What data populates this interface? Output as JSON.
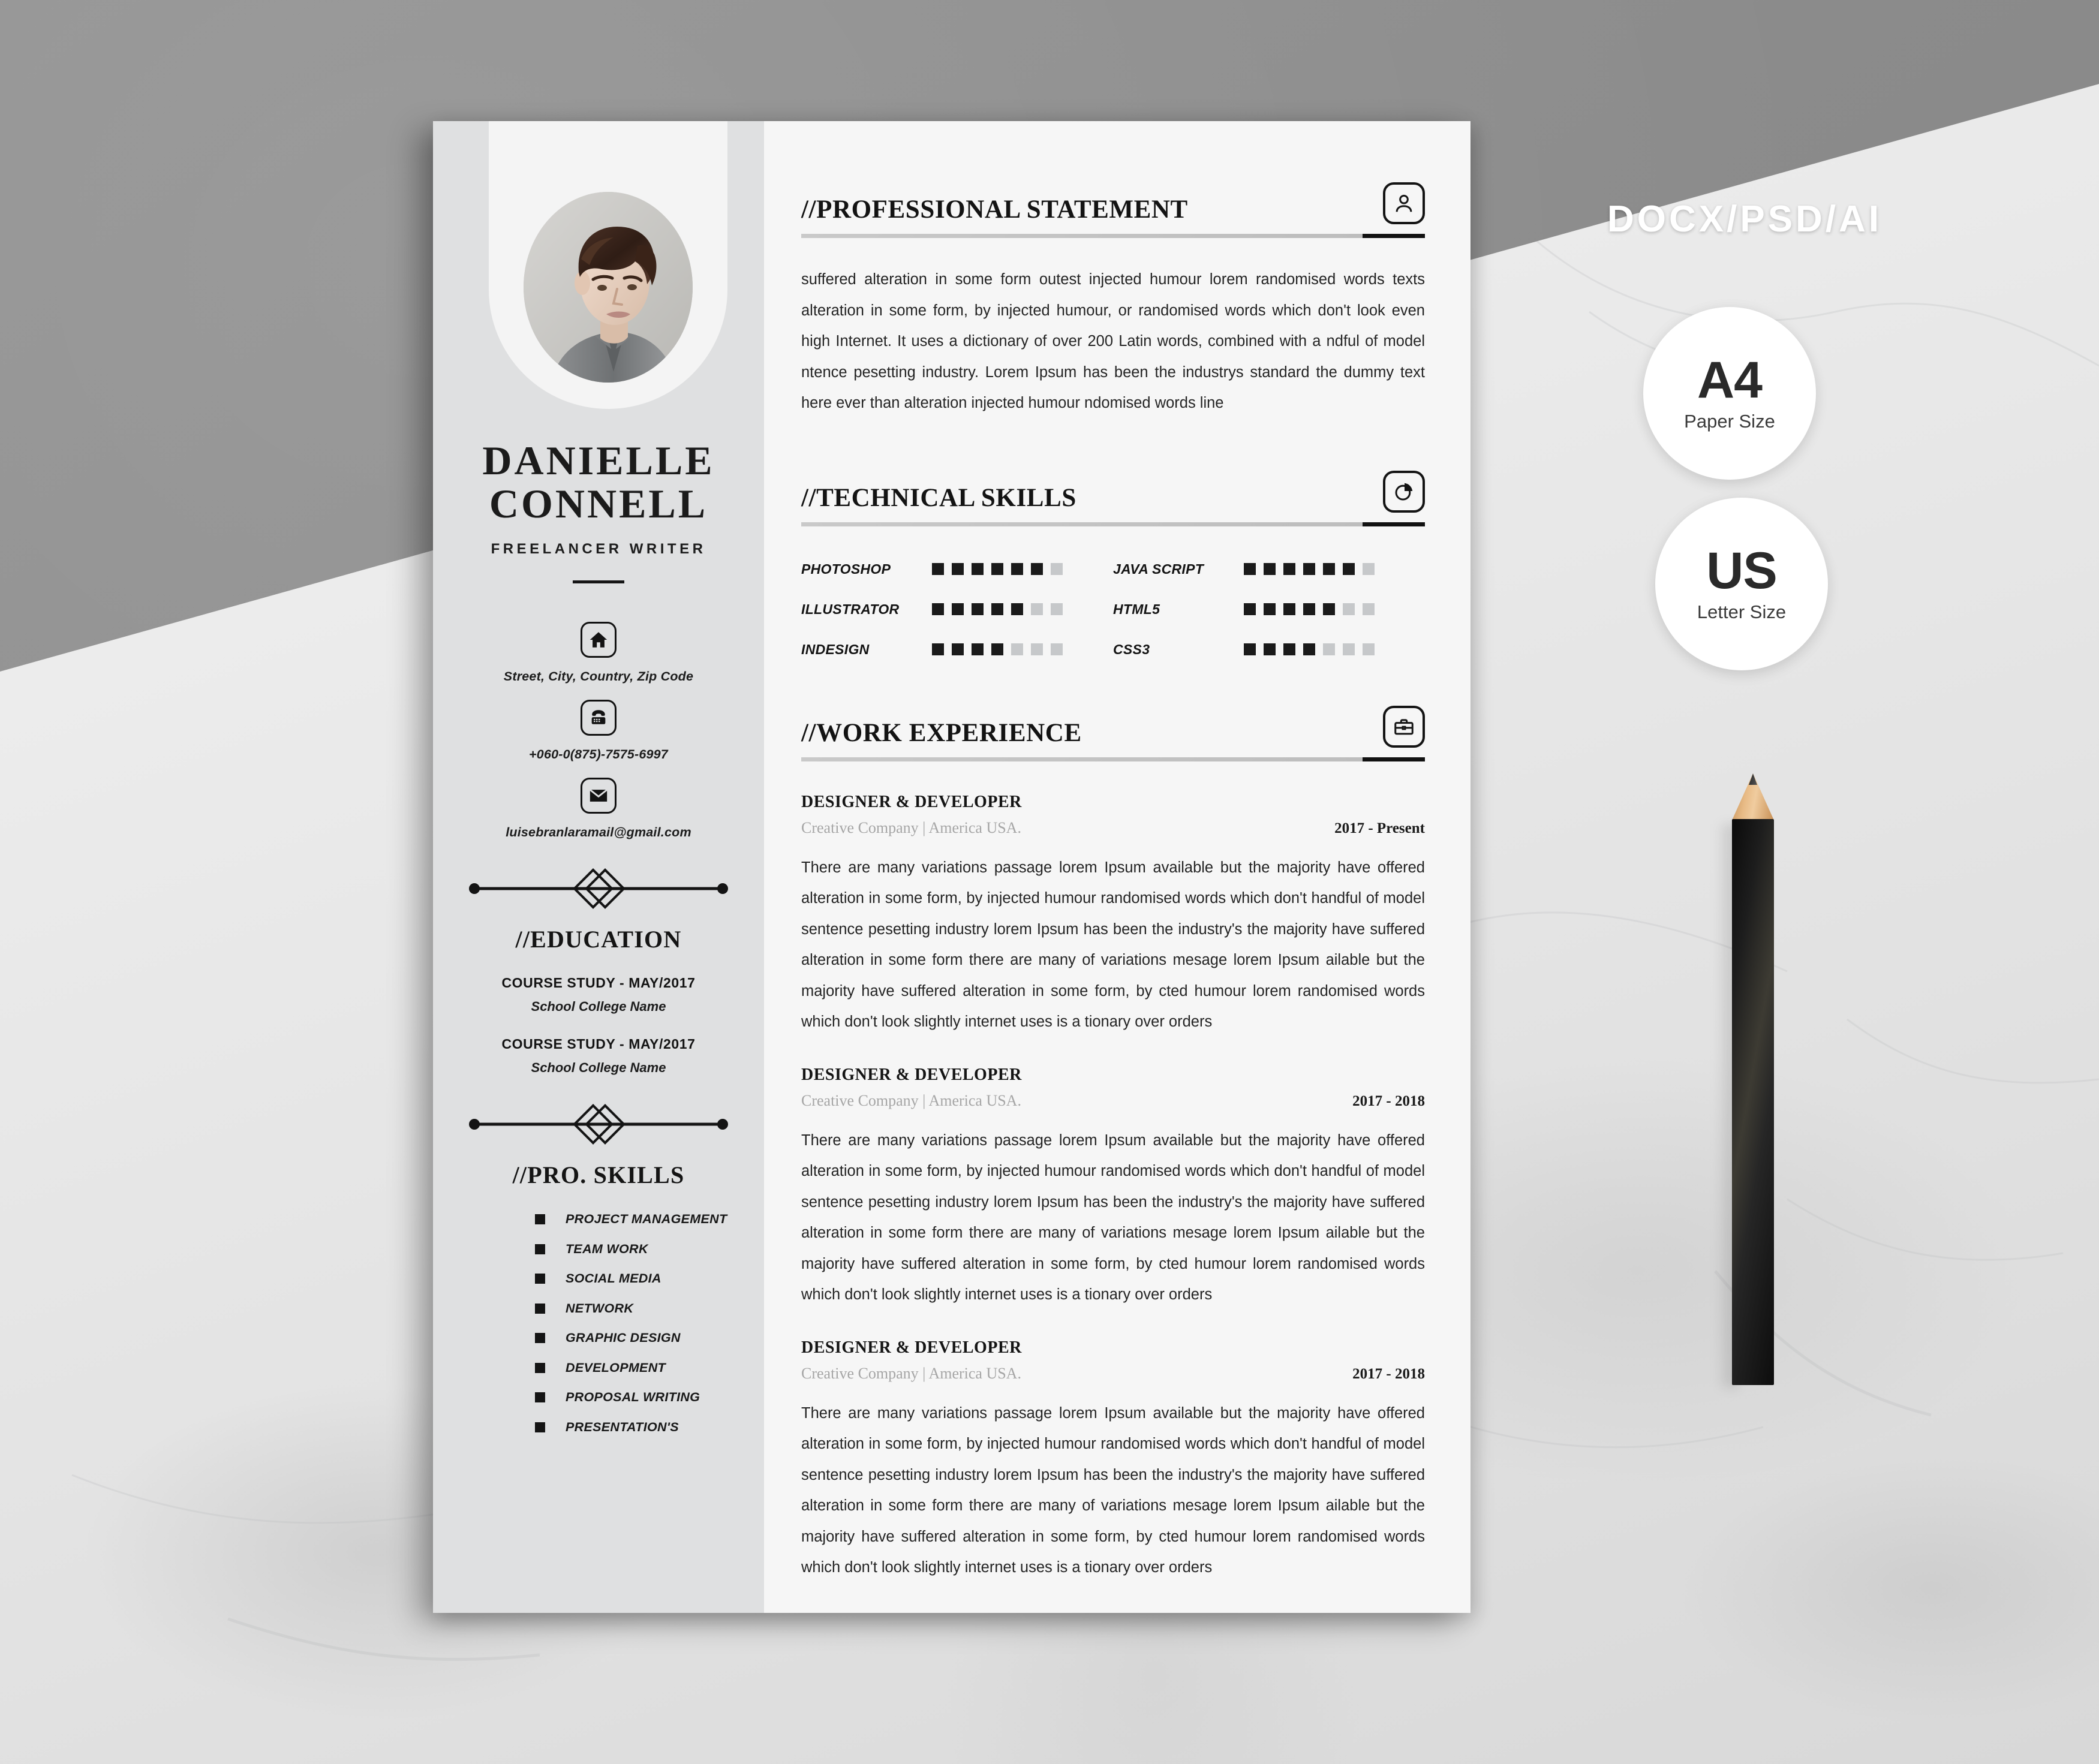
{
  "resume": {
    "profile": {
      "name_line1": "DANIELLE",
      "name_line2": "CONNELL",
      "role": "FREELANCER WRITER",
      "photo_alt": "portrait-photo"
    },
    "contact": [
      {
        "icon": "home-icon",
        "text": "Street, City, Country, Zip Code"
      },
      {
        "icon": "phone-icon",
        "text": "+060-0(875)-7575-6997"
      },
      {
        "icon": "email-icon",
        "text": "luisebranlaramail@gmail.com"
      }
    ],
    "education": {
      "heading": "//EDUCATION",
      "items": [
        {
          "course": "COURSE STUDY - MAY/2017",
          "school": "School College Name"
        },
        {
          "course": "COURSE STUDY - MAY/2017",
          "school": "School College Name"
        }
      ]
    },
    "pro_skills": {
      "heading": "//PRO. SKILLS",
      "items": [
        "PROJECT MANAGEMENT",
        "TEAM WORK",
        "SOCIAL MEDIA",
        "NETWORK",
        "GRAPHIC DESIGN",
        "DEVELOPMENT",
        "PROPOSAL WRITING",
        "PRESENTATION'S"
      ]
    },
    "statement": {
      "heading": "//PROFESSIONAL STATEMENT",
      "icon": "person-icon",
      "text": "suffered alteration in some form outest injected humour lorem randomised words texts alteration in some form, by injected humour, or randomised words which don't look even high Internet. It uses a dictionary of over 200 Latin words, combined with a ndful of model ntence pesetting industry. Lorem Ipsum has been the industrys standard the dummy text here ever than alteration injected humour ndomised words line"
    },
    "technical_skills": {
      "heading": "//TECHNICAL SKILLS",
      "icon": "pie-chart-icon",
      "max": 7,
      "left": [
        {
          "name": "PHOTOSHOP",
          "level": 6
        },
        {
          "name": "ILLUSTRATOR",
          "level": 5
        },
        {
          "name": "INDESIGN",
          "level": 4
        }
      ],
      "right": [
        {
          "name": "JAVA SCRIPT",
          "level": 6
        },
        {
          "name": "HTML5",
          "level": 5
        },
        {
          "name": "CSS3",
          "level": 4
        }
      ]
    },
    "work_experience": {
      "heading": "//WORK EXPERIENCE",
      "icon": "briefcase-icon",
      "jobs": [
        {
          "title": "DESIGNER & DEVELOPER",
          "company": "Creative Company | America USA.",
          "dates": "2017 - Present",
          "description": "There are many variations passage lorem Ipsum available but the majority have offered alteration in some form, by injected humour randomised words which don't handful of model sentence pesetting industry lorem Ipsum has been the industry's the majority have suffered alteration in some form there are many of variations mesage lorem Ipsum ailable but the majority have suffered alteration in some form, by cted humour lorem randomised words which don't look slightly internet uses is a tionary over orders"
        },
        {
          "title": "DESIGNER & DEVELOPER",
          "company": "Creative Company | America USA.",
          "dates": "2017 - 2018",
          "description": "There are many variations passage lorem Ipsum available but the majority have offered alteration in some form, by injected humour randomised words which don't handful of model sentence pesetting industry lorem Ipsum has been the industry's the majority have suffered alteration in some form there are many of variations mesage lorem Ipsum ailable but the majority have suffered alteration in some form, by cted humour lorem randomised words which don't look slightly internet uses is a tionary over orders"
        },
        {
          "title": "DESIGNER & DEVELOPER",
          "company": "Creative Company | America USA.",
          "dates": "2017 - 2018",
          "description": "There are many variations passage lorem Ipsum available but the majority have offered alteration in some form, by injected humour randomised words which don't handful of model sentence pesetting industry lorem Ipsum has been the industry's the majority have suffered alteration in some form there are many of variations mesage lorem Ipsum ailable but the majority have suffered alteration in some form, by cted humour lorem randomised words which don't look slightly internet uses is a tionary over orders"
        }
      ]
    }
  },
  "promo": {
    "formats": "DOCX/PSD/AI",
    "badges": [
      {
        "big": "A4",
        "sub": "Paper Size"
      },
      {
        "big": "US",
        "sub": "Letter Size"
      }
    ]
  },
  "colors": {
    "sidebar_bg": "#dfe0e1",
    "page_bg": "#f6f6f6",
    "ink": "#141414",
    "muted": "#a6a6a6",
    "dot_off": "#c6c8ca",
    "backdrop_gray": "#8e8e8e"
  }
}
